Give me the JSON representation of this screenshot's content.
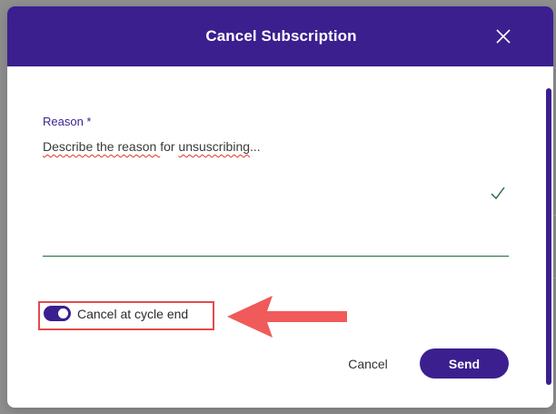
{
  "dialog": {
    "title": "Cancel Subscription",
    "close_icon": "close-icon"
  },
  "reason_field": {
    "label": "Reason *",
    "value_prefix": "Describe the reason ",
    "value_word_for": "for",
    "value_space": " ",
    "value_word_misspelled": "unsuscribing",
    "value_suffix": "...",
    "valid_icon": "check-icon"
  },
  "cycle_toggle": {
    "label": "Cancel at cycle end",
    "checked": true
  },
  "actions": {
    "cancel_label": "Cancel",
    "send_label": "Send"
  },
  "annotation": {
    "highlight_color": "#e34b4b",
    "arrow_color": "#f05a5a"
  },
  "colors": {
    "brand": "#3b1f8f",
    "valid": "#1f6b3a"
  }
}
